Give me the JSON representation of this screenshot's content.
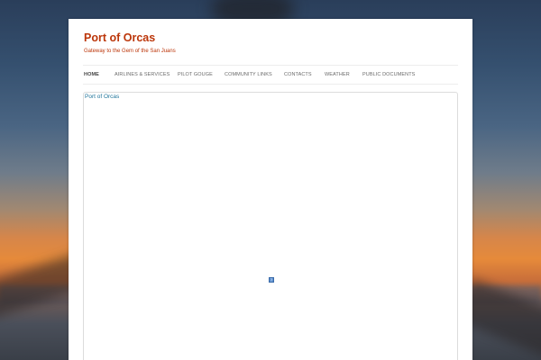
{
  "site": {
    "title": "Port of Orcas",
    "tagline": "Gateway to the Gem of the San Juans"
  },
  "nav": {
    "items": [
      {
        "label": "HOME",
        "active": true
      },
      {
        "label": "AIRLINES & SERVICES",
        "active": false
      },
      {
        "label": "PILOT GOUGE",
        "active": false
      },
      {
        "label": "COMMUNITY LINKS",
        "active": false
      },
      {
        "label": "CONTACTS",
        "active": false
      },
      {
        "label": "WEATHER",
        "active": false
      },
      {
        "label": "PUBLIC DOCUMENTS",
        "active": false
      }
    ]
  },
  "content": {
    "embed_link": "Port of Orcas",
    "loader_icon": "broken-image-icon"
  },
  "colors": {
    "title": "#bc360a",
    "link": "#21759b",
    "nav_text": "#6a6a6a"
  }
}
